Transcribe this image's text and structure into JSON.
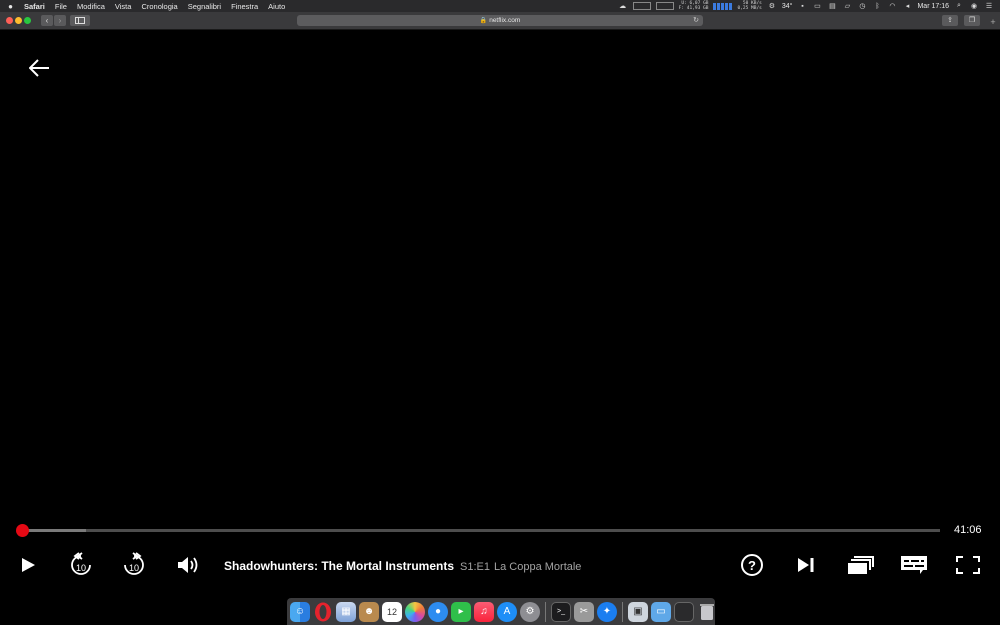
{
  "menubar": {
    "app_name": "Safari",
    "menus": [
      "File",
      "Modifica",
      "Vista",
      "Cronologia",
      "Segnalibri",
      "Finestra",
      "Aiuto"
    ],
    "status": {
      "mem_used": "U: 6,07 GB",
      "mem_free": "F: 41,93 GB",
      "net_up": "50 KB/s",
      "net_down": "0,25 MB/s",
      "temperature": "34°",
      "clock": "Mar 17:16"
    }
  },
  "browser": {
    "url": "netflix.com",
    "back_glyph": "‹",
    "forward_glyph": "›",
    "new_tab_glyph": "+"
  },
  "player": {
    "time_remaining": "41:06",
    "progress_fraction": 0.0,
    "buffered_fraction": 0.07,
    "show_title": "Shadowhunters: The Mortal Instruments",
    "episode_number": "S1:E1",
    "episode_title": "La Coppa Mortale",
    "rewind_seconds": "10",
    "forward_seconds": "10",
    "help_glyph": "?",
    "accent_color": "#e50914"
  },
  "dock": {
    "calendar_day": "12",
    "apps": [
      "finder-icon",
      "opera-icon",
      "preview-icon",
      "contacts-icon",
      "calendar-icon",
      "photos-icon",
      "messages-icon",
      "facetime-icon",
      "music-icon",
      "app-store-icon",
      "system-preferences-icon",
      "terminal-icon",
      "utility-icon",
      "safari-icon",
      "downloads-stack-icon",
      "folder-icon",
      "monitor-icon",
      "trash-icon"
    ]
  }
}
